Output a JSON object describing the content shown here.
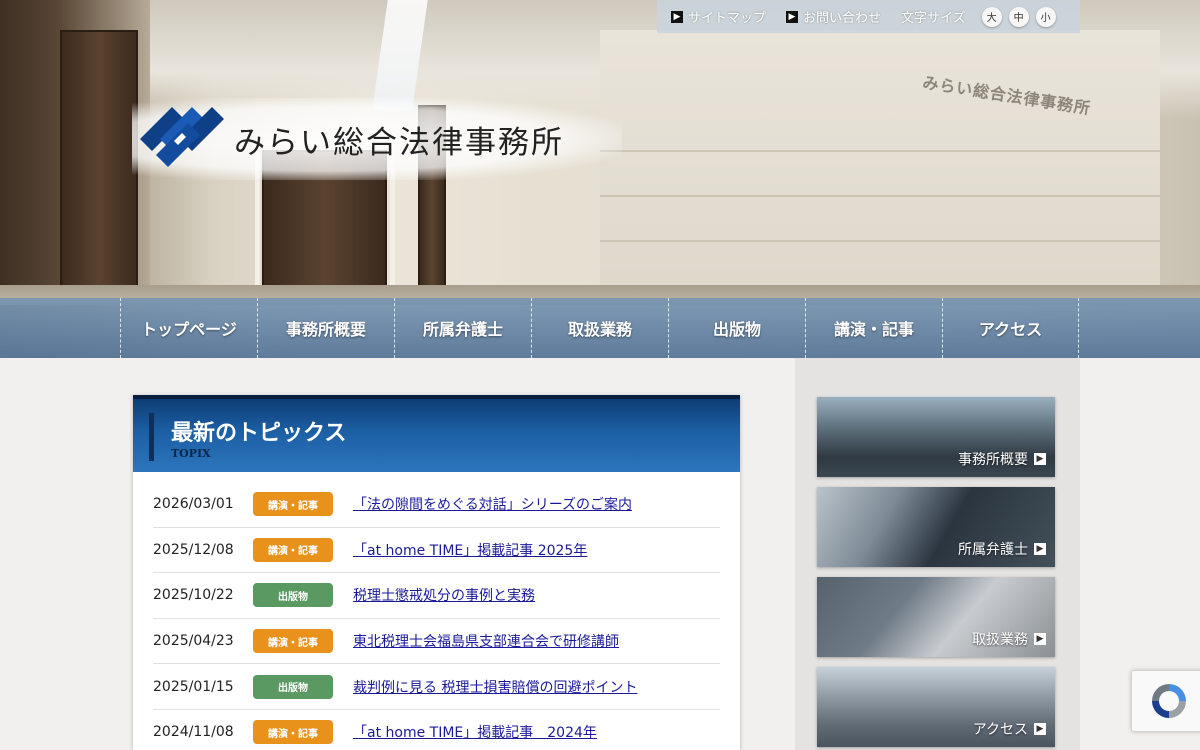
{
  "site": {
    "logo_text": "みらい総合法律事務所",
    "wall_sign": "みらい総合法律事務所"
  },
  "topbar": {
    "sitemap": "サイトマップ",
    "contact": "お問い合わせ",
    "font_size_label": "文字サイズ",
    "sizes": [
      "大",
      "中",
      "小"
    ]
  },
  "nav": {
    "items": [
      "トップページ",
      "事務所概要",
      "所属弁護士",
      "取扱業務",
      "出版物",
      "講演・記事",
      "アクセス"
    ]
  },
  "topics": {
    "title": "最新のトピックス",
    "subtitle": "TOPIX",
    "items": [
      {
        "date": "2026/03/01",
        "category": "講演・記事",
        "title": "「法の隙間をめぐる対話」シリーズのご案内"
      },
      {
        "date": "2025/12/08",
        "category": "講演・記事",
        "title": "「at home TIME」掲載記事 2025年"
      },
      {
        "date": "2025/10/22",
        "category": "出版物",
        "title": "税理士懲戒処分の事例と実務"
      },
      {
        "date": "2025/04/23",
        "category": "講演・記事",
        "title": "東北税理士会福島県支部連合会で研修講師"
      },
      {
        "date": "2025/01/15",
        "category": "出版物",
        "title": "裁判例に見る 税理士損害賠償の回避ポイント"
      },
      {
        "date": "2024/11/08",
        "category": "講演・記事",
        "title": "「at home TIME」掲載記事　2024年"
      }
    ]
  },
  "sidebar": {
    "cards": [
      "事務所概要",
      "所属弁護士",
      "取扱業務",
      "アクセス"
    ]
  },
  "colors": {
    "badge_lecture": "#e8921c",
    "badge_publication": "#5a9a62",
    "topics_header": "#1c5fa4",
    "link": "#1a1a9a"
  }
}
